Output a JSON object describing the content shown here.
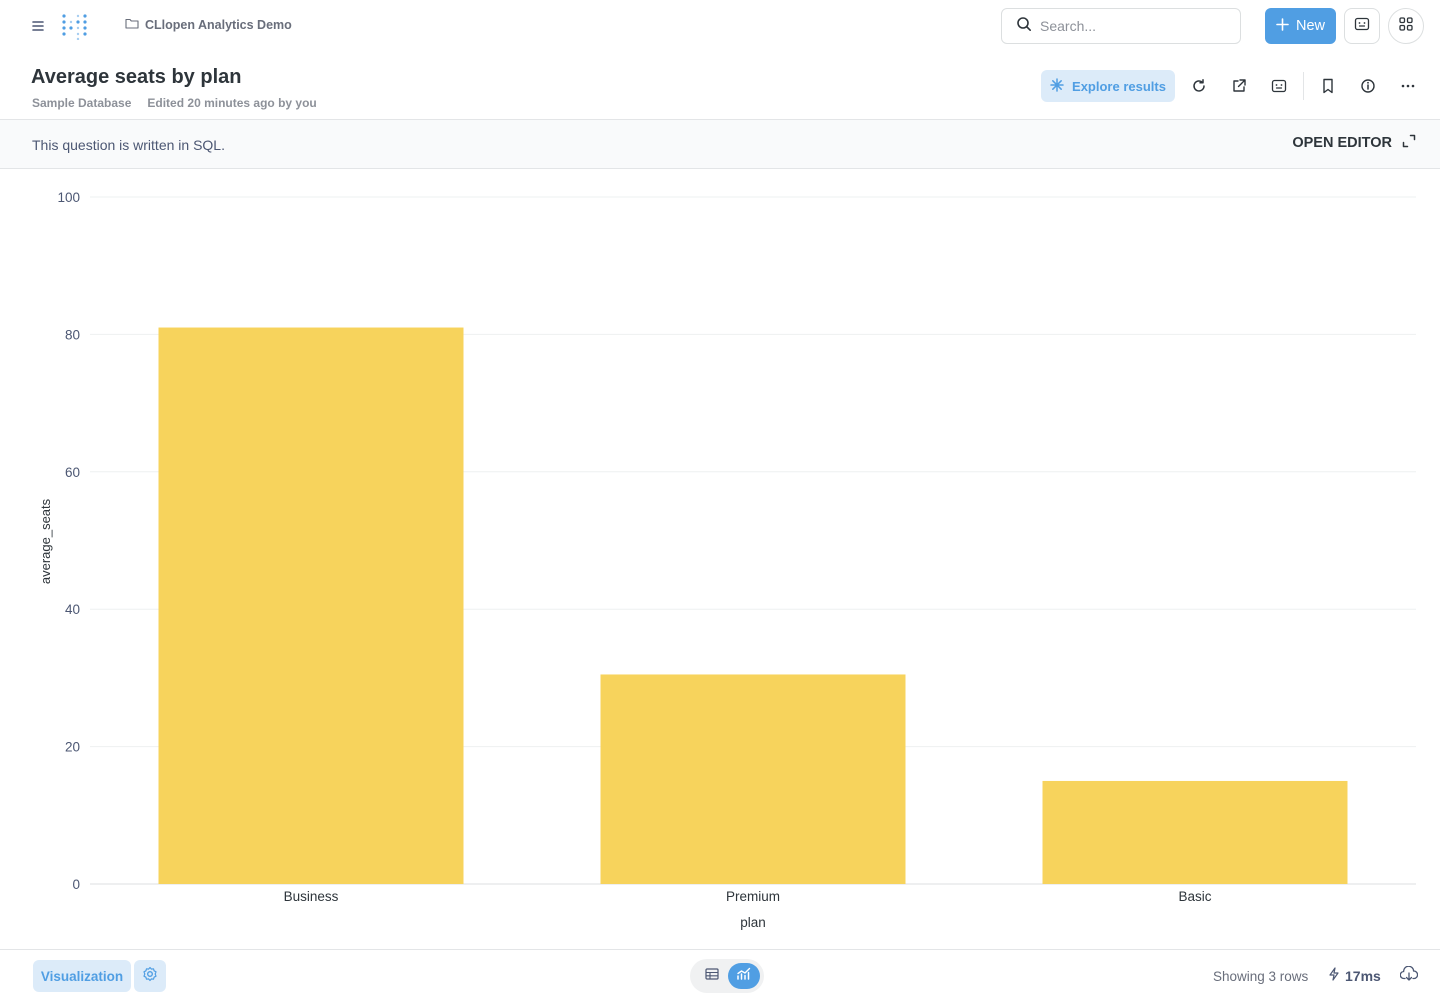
{
  "nav": {
    "collection": "CLlopen Analytics Demo",
    "search_placeholder": "Search...",
    "new_label": "New"
  },
  "header": {
    "title": "Average seats by plan",
    "database": "Sample Database",
    "edited": "Edited 20 minutes ago by you",
    "explore_label": "Explore results"
  },
  "sql_banner": {
    "text": "This question is written in SQL.",
    "open_editor": "OPEN EDITOR"
  },
  "chart_data": {
    "type": "bar",
    "categories": [
      "Business",
      "Premium",
      "Basic"
    ],
    "values": [
      81,
      30.5,
      15
    ],
    "xlabel": "plan",
    "ylabel": "average_seats",
    "ylim": [
      0,
      100
    ],
    "yticks": [
      0,
      20,
      40,
      60,
      80,
      100
    ],
    "grid": true,
    "bar_color": "#f7d35c",
    "grid_color": "#eef0f1",
    "tick_color": "#4c5773"
  },
  "footer": {
    "visualization_label": "Visualization",
    "rows": "Showing 3 rows",
    "timing": "17ms"
  },
  "colors": {
    "brand": "#509ee3",
    "brand_light": "#dcebf9",
    "text": "#2e353b"
  }
}
